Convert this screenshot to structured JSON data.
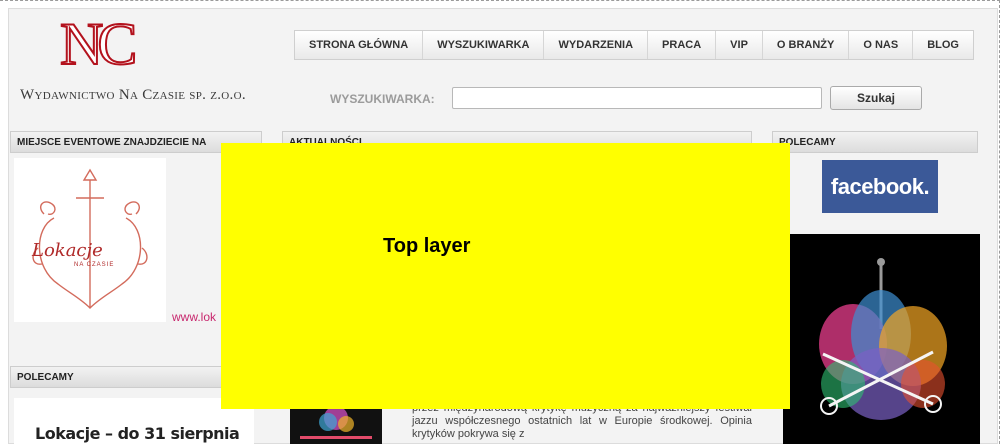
{
  "header": {
    "logo_mark": "NC",
    "logo_text": "Wydawnictwo Na Czasie sp. z.o.o.",
    "nav": [
      "STRONA GŁÓWNA",
      "WYSZUKIWARKA",
      "WYDARZENIA",
      "PRACA",
      "VIP",
      "O BRANŻY",
      "O NAS",
      "BLOG"
    ],
    "search": {
      "label": "WYSZUKIWARKA:",
      "value": "",
      "button": "Szukaj"
    }
  },
  "left_column": {
    "section_title": "MIEJSCE EVENTOWE ZNAJDZIECIE NA",
    "lokacje_logo_text": "Lokacje",
    "lokacje_logo_sub": "NA CZASIE",
    "site_link": "www.lok",
    "second_section_title": "POLECAMY",
    "promo_text": "Lokacje – do 31 sierpnia"
  },
  "center_column": {
    "section_title": "AKTUALNOŚCI",
    "article_text": "przez międzynarodową krytykę muzyczną za najważniejszy festiwal jazzu współczesnego ostatnich lat w Europie środkowej. Opinia krytyków pokrywa się z"
  },
  "right_column": {
    "section_title": "POLECAMY",
    "facebook_label": "facebook."
  },
  "overlay": {
    "title": "Top layer",
    "color": "#ffff00"
  },
  "colors": {
    "brand_red": "#b3121d",
    "facebook_blue": "#3b5998",
    "link_pink": "#c8286e"
  }
}
